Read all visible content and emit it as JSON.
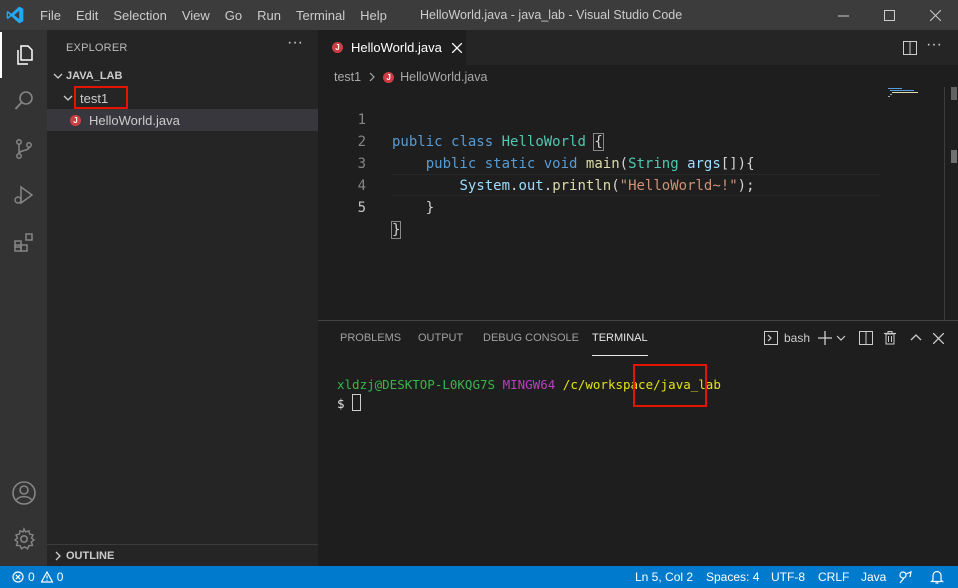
{
  "window": {
    "title": "HelloWorld.java - java_lab - Visual Studio Code",
    "menu": [
      "File",
      "Edit",
      "Selection",
      "View",
      "Go",
      "Run",
      "Terminal",
      "Help"
    ]
  },
  "sidebar": {
    "title": "EXPLORER",
    "more": "···",
    "workspace": "JAVA_LAB",
    "folder": "test1",
    "file": "HelloWorld.java",
    "outline": "OUTLINE"
  },
  "editor": {
    "tab_label": "HelloWorld.java",
    "breadcrumb": {
      "folder": "test1",
      "file": "HelloWorld.java"
    },
    "lines": [
      {
        "num": "1",
        "text": "public class HelloWorld {"
      },
      {
        "num": "2",
        "text": "    public static void main(String args[]){"
      },
      {
        "num": "3",
        "text": "        System.out.println(\"HelloWorld~!\");"
      },
      {
        "num": "4",
        "text": "    }"
      },
      {
        "num": "5",
        "text": "}"
      }
    ],
    "current_line": "5"
  },
  "panel": {
    "tabs": [
      "PROBLEMS",
      "OUTPUT",
      "DEBUG CONSOLE",
      "TERMINAL"
    ],
    "active_tab": "TERMINAL",
    "shell": "bash",
    "terminal": {
      "user_host": "xldzj@DESKTOP-L0KQG7S",
      "env": "MINGW64",
      "path_prefix": "/c/workspace/",
      "path_last": "java_lab",
      "prompt": "$"
    }
  },
  "statusbar": {
    "errors": "0",
    "warnings": "0",
    "position": "Ln 5, Col 2",
    "spaces": "Spaces: 4",
    "encoding": "UTF-8",
    "eol": "CRLF",
    "language": "Java"
  },
  "colors": {
    "accent": "#007acc",
    "highlight_box": "#e51400",
    "java_icon": "#cc3e44"
  }
}
